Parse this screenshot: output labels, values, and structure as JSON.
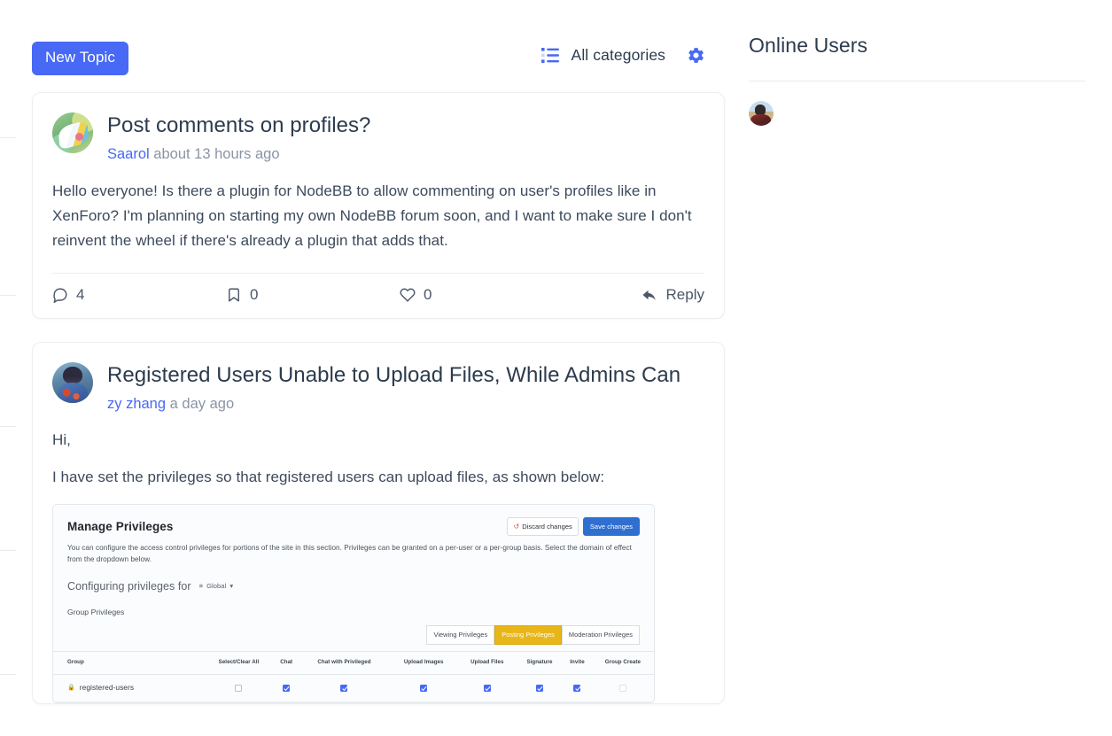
{
  "toolbar": {
    "new_topic_label": "New Topic",
    "category_label": "All categories",
    "list_icon": "list-icon",
    "gear_icon": "gear-icon",
    "accent_color": "#4769f5"
  },
  "posts": [
    {
      "title": "Post comments on profiles?",
      "author": "Saarol",
      "time": "about 13 hours ago",
      "avatar": "saarol-avatar",
      "paragraphs": [
        "Hello everyone! Is there a plugin for NodeBB to allow commenting on user's profiles like in XenForo? I'm planning on starting my own NodeBB forum soon, and I want to make sure I don't reinvent the wheel if there's already a plugin that adds that."
      ],
      "actions": {
        "comments_count": "4",
        "bookmarks_count": "0",
        "likes_count": "0",
        "reply_label": "Reply"
      }
    },
    {
      "title": "Registered Users Unable to Upload Files, While Admins Can",
      "author": "zy zhang",
      "time": "a day ago",
      "avatar": "zy-zhang-avatar",
      "paragraphs": [
        "Hi,",
        "I have set the privileges so that registered users can upload files, as shown below:"
      ]
    }
  ],
  "embedded_screenshot": {
    "title": "Manage Privileges",
    "discard_label": "Discard changes",
    "save_label": "Save changes",
    "description": "You can configure the access control privileges for portions of the site in this section. Privileges can be granted on a per-user or a per-group basis. Select the domain of effect from the dropdown below.",
    "configuring_label": "Configuring privileges for",
    "domain_value": "Global",
    "group_privileges_label": "Group Privileges",
    "tabs": [
      {
        "label": "Viewing Privileges",
        "active": false
      },
      {
        "label": "Posting Privileges",
        "active": true
      },
      {
        "label": "Moderation Privileges",
        "active": false
      }
    ],
    "columns": [
      "Group",
      "Select/Clear All",
      "Chat",
      "Chat with Privileged",
      "Upload Images",
      "Upload Files",
      "Signature",
      "Invite",
      "Group Create"
    ],
    "rows": [
      {
        "group": "registered-users",
        "select_all": false,
        "values": [
          false,
          true,
          true,
          true,
          true,
          true,
          true,
          false
        ]
      }
    ]
  },
  "sidebar": {
    "title": "Online Users",
    "users": [
      {
        "avatar": "online-user-avatar"
      }
    ]
  },
  "left_rail": {
    "tick_positions": [
      155,
      333,
      481,
      621,
      761
    ]
  }
}
